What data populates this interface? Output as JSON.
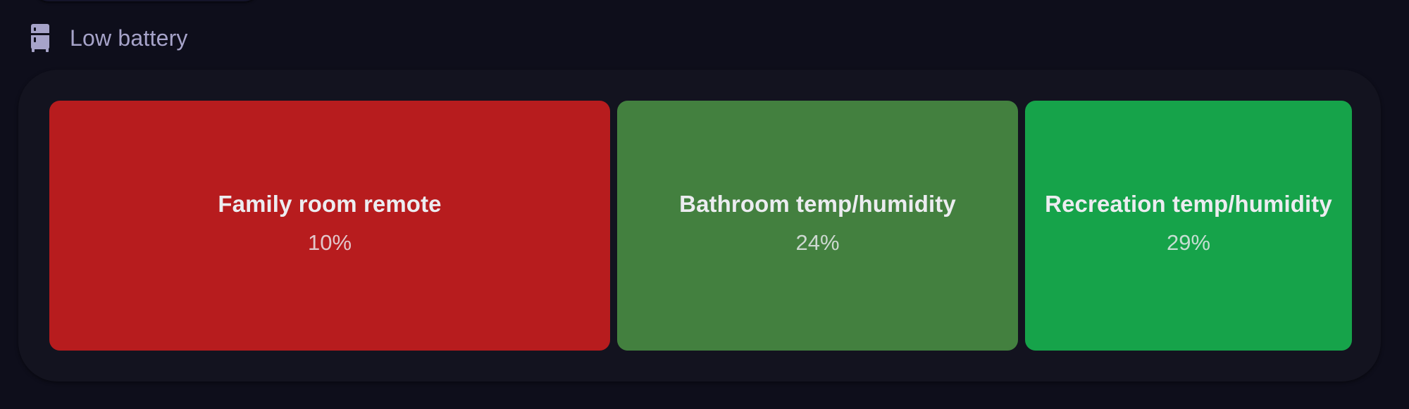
{
  "section": {
    "title": "Low battery",
    "icon": "fridge-icon",
    "icon_color": "#a6a3c9"
  },
  "tiles": [
    {
      "name": "Family room remote",
      "value": "10%",
      "color": "#b71c1e"
    },
    {
      "name": "Bathroom temp/humidity",
      "value": "24%",
      "color": "#43803f"
    },
    {
      "name": "Recreation temp/humidity",
      "value": "29%",
      "color": "#16a34a"
    }
  ],
  "colors": {
    "background": "#0e0e1b",
    "card": "#13131f",
    "text": "#ececf0"
  }
}
